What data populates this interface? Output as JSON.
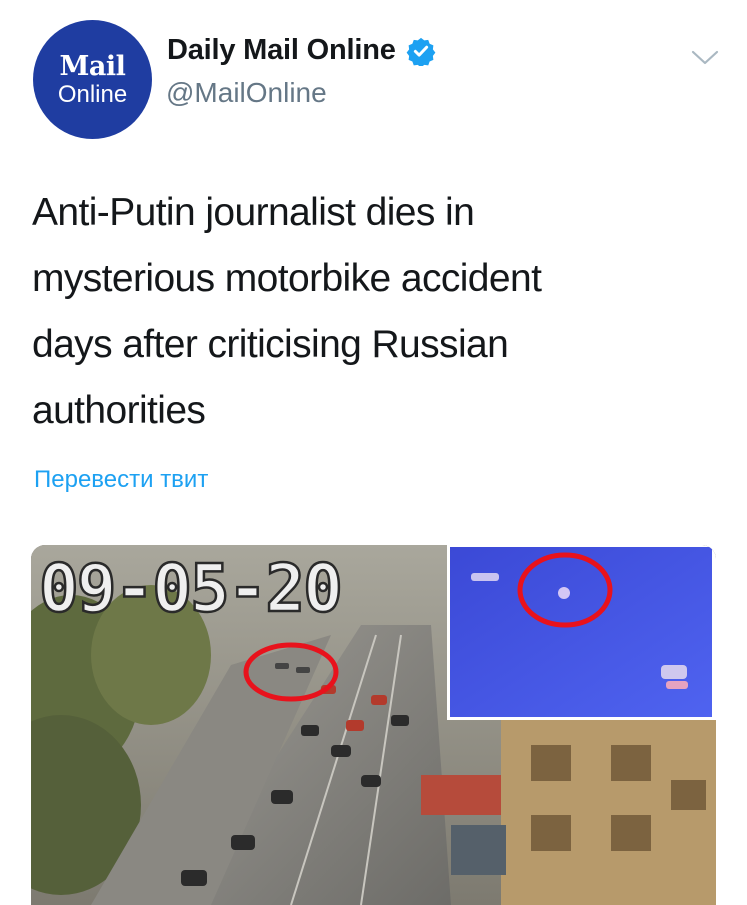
{
  "author": {
    "avatar": {
      "logo_top": "Mail",
      "logo_bottom": "Online",
      "color": "#1f3da1"
    },
    "display_name": "Daily Mail Online",
    "verified_icon": "verified-badge-icon",
    "handle": "@MailOnline"
  },
  "menu_icon": "chevron-down-icon",
  "tweet": {
    "lines": [
      "Anti-Putin journalist dies in",
      "mysterious motorbike accident",
      "days after criticising Russian",
      "authorities"
    ],
    "translate_label": "Перевести твит"
  },
  "media": {
    "timestamp_overlay": "09-05-20"
  },
  "colors": {
    "link": "#1da1f2",
    "secondary_text": "#657786",
    "verified": "#1da1f2",
    "highlight_circle": "#e8121c"
  }
}
